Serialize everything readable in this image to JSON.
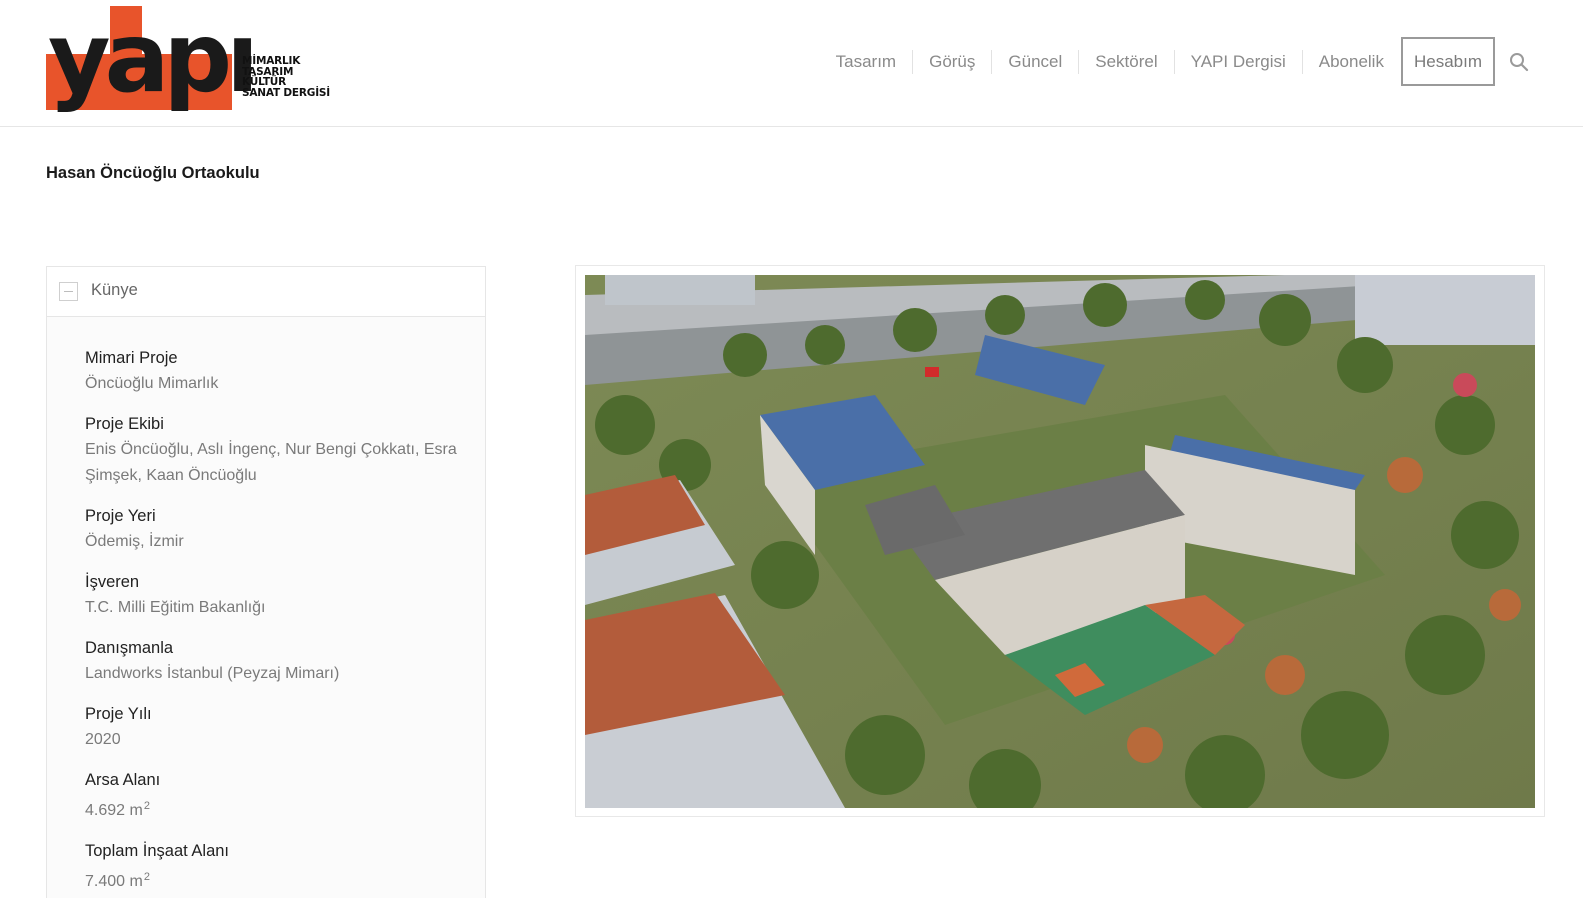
{
  "logo": {
    "word": "yapı",
    "lines": [
      "MİMARLIK",
      "TASARIM",
      "KÜLTÜR",
      "SANAT DERGİSİ"
    ]
  },
  "nav": {
    "items": [
      "Tasarım",
      "Görüş",
      "Güncel",
      "Sektörel",
      "YAPI Dergisi",
      "Abonelik"
    ],
    "account": "Hesabım",
    "search_icon": "search-icon"
  },
  "page": {
    "title": "Hasan Öncüoğlu Ortaokulu"
  },
  "card": {
    "title": "Künye",
    "fields": [
      {
        "label": "Mimari Proje",
        "value": "Öncüoğlu Mimarlık"
      },
      {
        "label": "Proje Ekibi",
        "value": "Enis Öncüoğlu, Aslı İngenç, Nur Bengi Çokkatı, Esra Şimşek, Kaan Öncüoğlu"
      },
      {
        "label": "Proje Yeri",
        "value": "Ödemiş, İzmir"
      },
      {
        "label": "İşveren",
        "value": "T.C. Milli Eğitim Bakanlığı"
      },
      {
        "label": "Danışmanla",
        "value": "Landworks İstanbul (Peyzaj Mimarı)"
      },
      {
        "label": "Proje Yılı",
        "value": "2020"
      },
      {
        "label": "Arsa Alanı",
        "value": "4.692 m",
        "sup": "2"
      },
      {
        "label": "Toplam İnşaat Alanı",
        "value": "7.400 m",
        "sup": "2"
      }
    ]
  },
  "colors": {
    "brand": "#e8542b",
    "nav_text": "#8a8a8a"
  }
}
